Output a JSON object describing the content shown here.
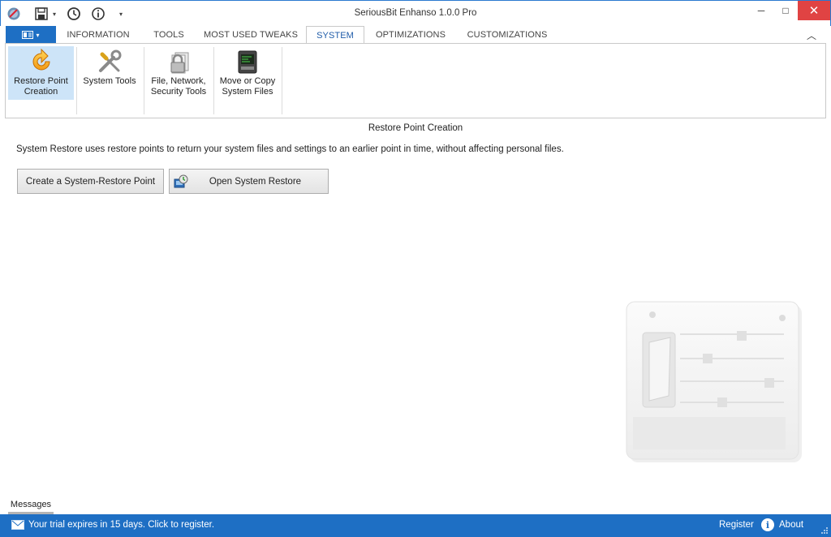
{
  "window": {
    "title": "SeriousBit Enhanso 1.0.0 Pro",
    "minimize": "─",
    "maximize": "□",
    "close": "✕"
  },
  "quick_access": {
    "icons": [
      "app-logo-icon",
      "save-icon",
      "history-icon",
      "info-icon"
    ],
    "customize_symbol": "▾"
  },
  "tabs": {
    "file_menu_symbol": "▾",
    "items": [
      {
        "label": "INFORMATION"
      },
      {
        "label": "TOOLS"
      },
      {
        "label": "MOST USED TWEAKS"
      },
      {
        "label": "SYSTEM",
        "active": true
      },
      {
        "label": "OPTIMIZATIONS"
      },
      {
        "label": "CUSTOMIZATIONS"
      }
    ],
    "collapse_symbol": "︿"
  },
  "ribbon": {
    "buttons": [
      {
        "label_1": "Restore Point",
        "label_2": "Creation",
        "icon": "restore-point-icon",
        "selected": true
      },
      {
        "label_1": "System Tools",
        "label_2": "",
        "icon": "tools-icon"
      },
      {
        "label_1": "File, Network,",
        "label_2": "Security Tools",
        "icon": "security-lock-icon"
      },
      {
        "label_1": "Move or Copy",
        "label_2": "System Files",
        "icon": "system-files-icon"
      }
    ]
  },
  "content": {
    "section_title": "Restore Point Creation",
    "description": "System Restore uses restore points to return your system files and settings to an earlier point in time, without affecting personal files.",
    "create_button": "Create a System-Restore Point",
    "open_button": "Open System Restore"
  },
  "messages_tab": "Messages",
  "status": {
    "trial": "Your trial expires in 15 days. Click to register.",
    "register": "Register",
    "about": "About",
    "about_icon_glyph": "i"
  },
  "colors": {
    "accent": "#1e6fc4",
    "close_red": "#e04343",
    "selected_ribbon": "#cde4f8"
  }
}
